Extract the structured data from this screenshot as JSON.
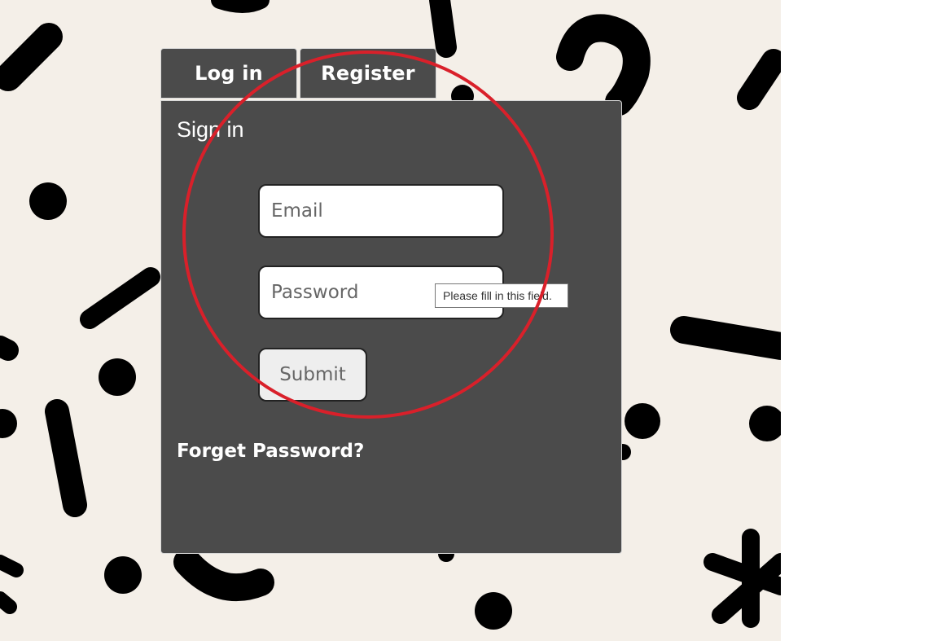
{
  "tabs": {
    "login_label": "Log in",
    "register_label": "Register"
  },
  "form": {
    "title": "Sign in",
    "email_placeholder": "Email",
    "password_placeholder": "Password",
    "submit_label": "Submit",
    "forget_label": "Forget Password?"
  },
  "tooltip": {
    "text": "Please fill in this field."
  },
  "colors": {
    "page_background": "#f4efe8",
    "panel": "#4b4b4b",
    "annotation_circle": "#d9202a"
  }
}
